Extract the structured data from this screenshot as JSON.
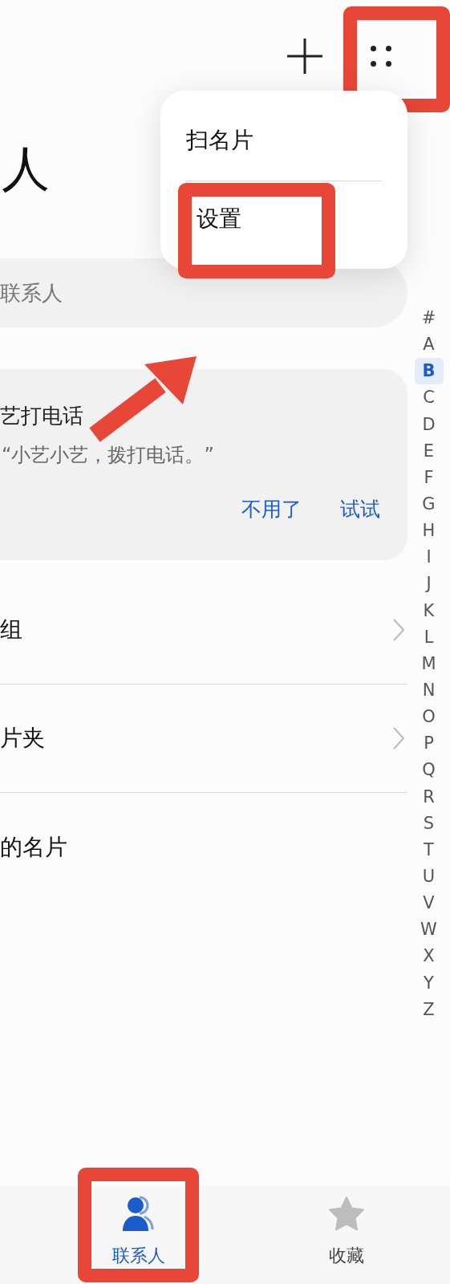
{
  "header": {
    "title": "人"
  },
  "more_menu": {
    "button_highlighted": true,
    "items": [
      {
        "label": "扫名片",
        "highlighted": false
      },
      {
        "label": "设置",
        "highlighted": true
      }
    ]
  },
  "search": {
    "placeholder": "联系人"
  },
  "tip_card": {
    "title": "艺打电话",
    "text": "“小艺小艺，拨打电话。”",
    "actions": [
      "不用了",
      "试试"
    ]
  },
  "arrow_annotation": true,
  "rows": [
    {
      "label": "组",
      "chevron": true
    },
    {
      "label": "片夹",
      "chevron": true
    },
    {
      "label": "的名片",
      "chevron": false
    }
  ],
  "index_bar": [
    {
      "letter": "#",
      "selected": false
    },
    {
      "letter": "A",
      "selected": false
    },
    {
      "letter": "B",
      "selected": true
    },
    {
      "letter": "C",
      "selected": false
    },
    {
      "letter": "D",
      "selected": false
    },
    {
      "letter": "E",
      "selected": false
    },
    {
      "letter": "F",
      "selected": false
    },
    {
      "letter": "G",
      "selected": false
    },
    {
      "letter": "H",
      "selected": false
    },
    {
      "letter": "I",
      "selected": false
    },
    {
      "letter": "J",
      "selected": false
    },
    {
      "letter": "K",
      "selected": false
    },
    {
      "letter": "L",
      "selected": false
    },
    {
      "letter": "M",
      "selected": false
    },
    {
      "letter": "N",
      "selected": false
    },
    {
      "letter": "O",
      "selected": false
    },
    {
      "letter": "P",
      "selected": false
    },
    {
      "letter": "Q",
      "selected": false
    },
    {
      "letter": "R",
      "selected": false
    },
    {
      "letter": "S",
      "selected": false
    },
    {
      "letter": "T",
      "selected": false
    },
    {
      "letter": "U",
      "selected": false
    },
    {
      "letter": "V",
      "selected": false
    },
    {
      "letter": "W",
      "selected": false
    },
    {
      "letter": "X",
      "selected": false
    },
    {
      "letter": "Y",
      "selected": false
    },
    {
      "letter": "Z",
      "selected": false
    }
  ],
  "bottom_nav": [
    {
      "label": "联系人",
      "selected": true,
      "highlighted": true
    },
    {
      "label": "收藏",
      "selected": false,
      "highlighted": false
    }
  ]
}
